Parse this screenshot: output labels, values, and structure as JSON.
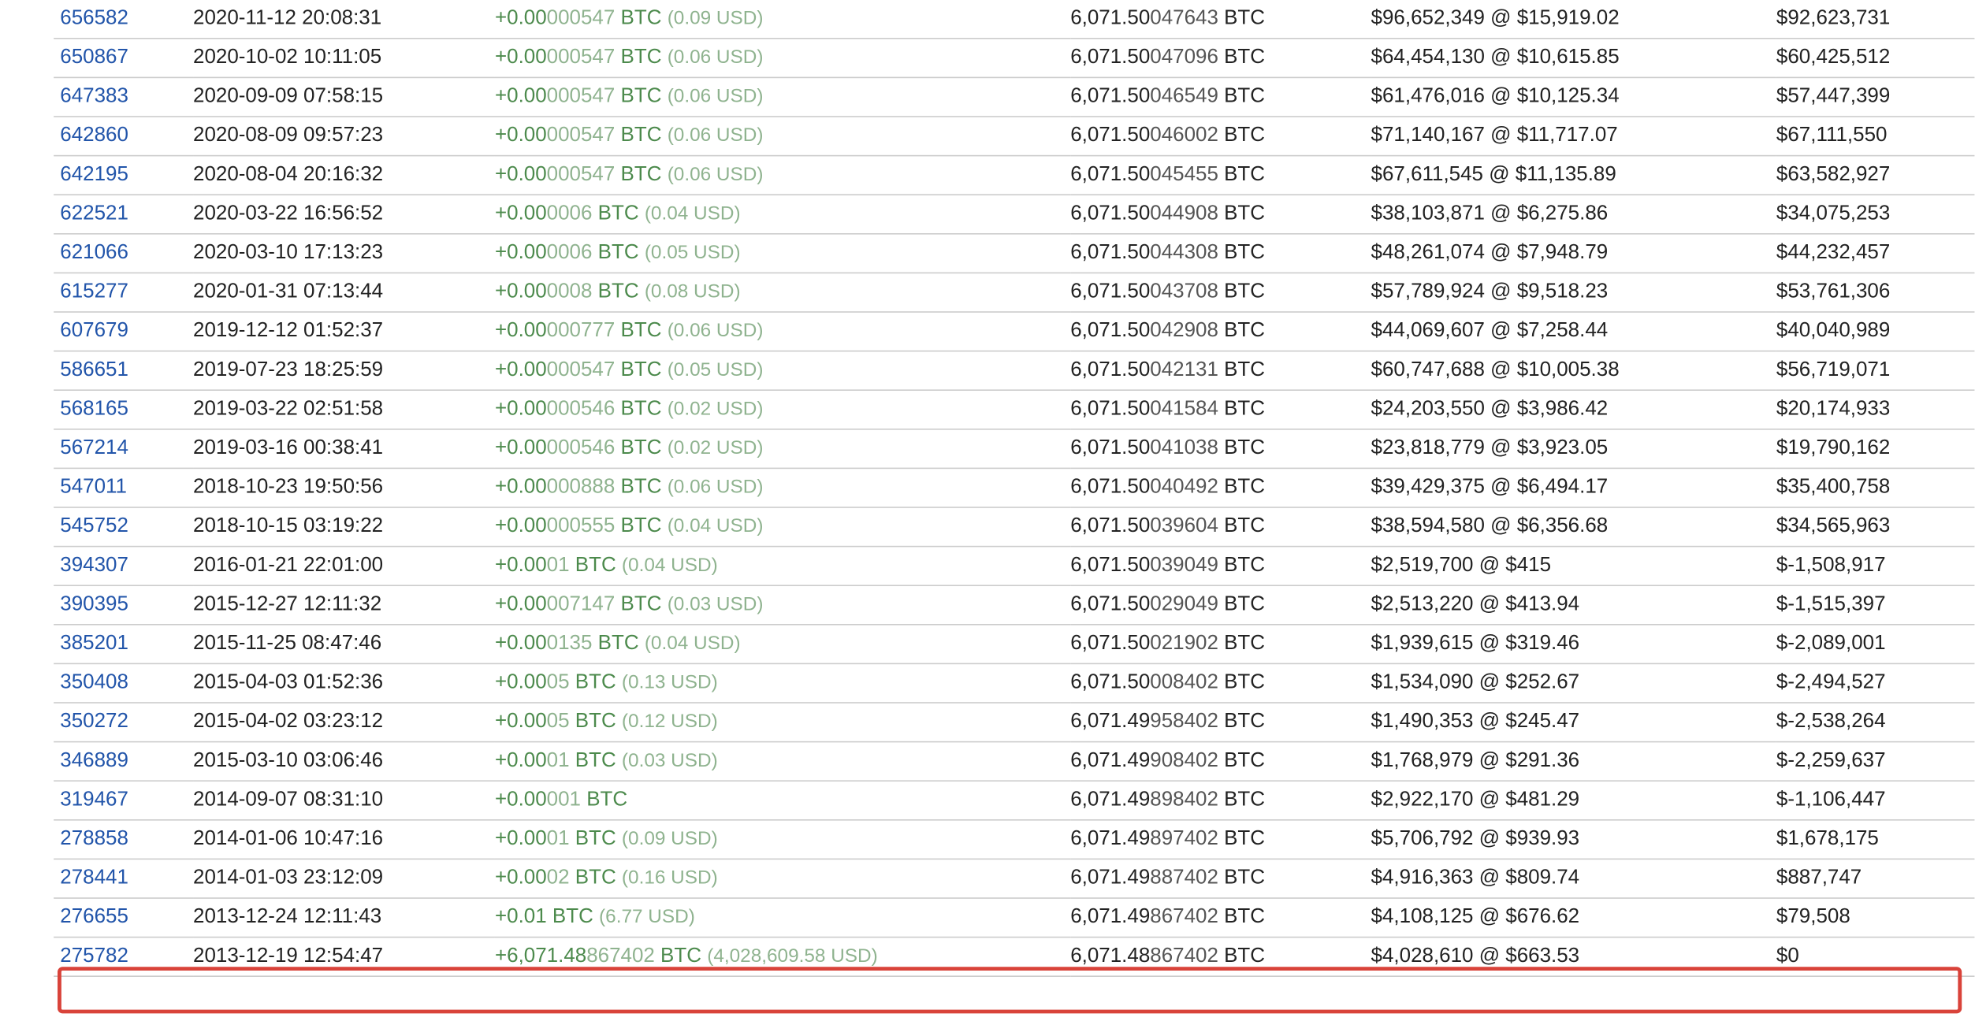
{
  "rows": [
    {
      "block": "656582",
      "time": "2020-11-12 20:08:31",
      "amt_main": "+0.00",
      "amt_dim": "000547",
      "amt_unit": " BTC",
      "amt_usd": "(0.09 USD)",
      "bal_main": "6,071.50",
      "bal_dim": "047643",
      "bal_unit": " BTC",
      "value": "$96,652,349 @ $15,919.02",
      "profit": "$92,623,731"
    },
    {
      "block": "650867",
      "time": "2020-10-02 10:11:05",
      "amt_main": "+0.00",
      "amt_dim": "000547",
      "amt_unit": " BTC",
      "amt_usd": "(0.06 USD)",
      "bal_main": "6,071.50",
      "bal_dim": "047096",
      "bal_unit": " BTC",
      "value": "$64,454,130 @ $10,615.85",
      "profit": "$60,425,512"
    },
    {
      "block": "647383",
      "time": "2020-09-09 07:58:15",
      "amt_main": "+0.00",
      "amt_dim": "000547",
      "amt_unit": " BTC",
      "amt_usd": "(0.06 USD)",
      "bal_main": "6,071.50",
      "bal_dim": "046549",
      "bal_unit": " BTC",
      "value": "$61,476,016 @ $10,125.34",
      "profit": "$57,447,399"
    },
    {
      "block": "642860",
      "time": "2020-08-09 09:57:23",
      "amt_main": "+0.00",
      "amt_dim": "000547",
      "amt_unit": " BTC",
      "amt_usd": "(0.06 USD)",
      "bal_main": "6,071.50",
      "bal_dim": "046002",
      "bal_unit": " BTC",
      "value": "$71,140,167 @ $11,717.07",
      "profit": "$67,111,550"
    },
    {
      "block": "642195",
      "time": "2020-08-04 20:16:32",
      "amt_main": "+0.00",
      "amt_dim": "000547",
      "amt_unit": " BTC",
      "amt_usd": "(0.06 USD)",
      "bal_main": "6,071.50",
      "bal_dim": "045455",
      "bal_unit": " BTC",
      "value": "$67,611,545 @ $11,135.89",
      "profit": "$63,582,927"
    },
    {
      "block": "622521",
      "time": "2020-03-22 16:56:52",
      "amt_main": "+0.00",
      "amt_dim": "0006",
      "amt_unit": " BTC",
      "amt_usd": "(0.04 USD)",
      "bal_main": "6,071.50",
      "bal_dim": "044908",
      "bal_unit": " BTC",
      "value": "$38,103,871 @ $6,275.86",
      "profit": "$34,075,253"
    },
    {
      "block": "621066",
      "time": "2020-03-10 17:13:23",
      "amt_main": "+0.00",
      "amt_dim": "0006",
      "amt_unit": " BTC",
      "amt_usd": "(0.05 USD)",
      "bal_main": "6,071.50",
      "bal_dim": "044308",
      "bal_unit": " BTC",
      "value": "$48,261,074 @ $7,948.79",
      "profit": "$44,232,457"
    },
    {
      "block": "615277",
      "time": "2020-01-31 07:13:44",
      "amt_main": "+0.00",
      "amt_dim": "0008",
      "amt_unit": " BTC",
      "amt_usd": "(0.08 USD)",
      "bal_main": "6,071.50",
      "bal_dim": "043708",
      "bal_unit": " BTC",
      "value": "$57,789,924 @ $9,518.23",
      "profit": "$53,761,306"
    },
    {
      "block": "607679",
      "time": "2019-12-12 01:52:37",
      "amt_main": "+0.00",
      "amt_dim": "000777",
      "amt_unit": " BTC",
      "amt_usd": "(0.06 USD)",
      "bal_main": "6,071.50",
      "bal_dim": "042908",
      "bal_unit": " BTC",
      "value": "$44,069,607 @ $7,258.44",
      "profit": "$40,040,989"
    },
    {
      "block": "586651",
      "time": "2019-07-23 18:25:59",
      "amt_main": "+0.00",
      "amt_dim": "000547",
      "amt_unit": " BTC",
      "amt_usd": "(0.05 USD)",
      "bal_main": "6,071.50",
      "bal_dim": "042131",
      "bal_unit": " BTC",
      "value": "$60,747,688 @ $10,005.38",
      "profit": "$56,719,071"
    },
    {
      "block": "568165",
      "time": "2019-03-22 02:51:58",
      "amt_main": "+0.00",
      "amt_dim": "000546",
      "amt_unit": " BTC",
      "amt_usd": "(0.02 USD)",
      "bal_main": "6,071.50",
      "bal_dim": "041584",
      "bal_unit": " BTC",
      "value": "$24,203,550 @ $3,986.42",
      "profit": "$20,174,933"
    },
    {
      "block": "567214",
      "time": "2019-03-16 00:38:41",
      "amt_main": "+0.00",
      "amt_dim": "000546",
      "amt_unit": " BTC",
      "amt_usd": "(0.02 USD)",
      "bal_main": "6,071.50",
      "bal_dim": "041038",
      "bal_unit": " BTC",
      "value": "$23,818,779 @ $3,923.05",
      "profit": "$19,790,162"
    },
    {
      "block": "547011",
      "time": "2018-10-23 19:50:56",
      "amt_main": "+0.00",
      "amt_dim": "000888",
      "amt_unit": " BTC",
      "amt_usd": "(0.06 USD)",
      "bal_main": "6,071.50",
      "bal_dim": "040492",
      "bal_unit": " BTC",
      "value": "$39,429,375 @ $6,494.17",
      "profit": "$35,400,758"
    },
    {
      "block": "545752",
      "time": "2018-10-15 03:19:22",
      "amt_main": "+0.00",
      "amt_dim": "000555",
      "amt_unit": " BTC",
      "amt_usd": "(0.04 USD)",
      "bal_main": "6,071.50",
      "bal_dim": "039604",
      "bal_unit": " BTC",
      "value": "$38,594,580 @ $6,356.68",
      "profit": "$34,565,963"
    },
    {
      "block": "394307",
      "time": "2016-01-21 22:01:00",
      "amt_main": "+0.00",
      "amt_dim": "01",
      "amt_unit": " BTC",
      "amt_usd": "(0.04 USD)",
      "bal_main": "6,071.50",
      "bal_dim": "039049",
      "bal_unit": " BTC",
      "value": "$2,519,700 @ $415",
      "profit": "$-1,508,917"
    },
    {
      "block": "390395",
      "time": "2015-12-27 12:11:32",
      "amt_main": "+0.00",
      "amt_dim": "007147",
      "amt_unit": " BTC",
      "amt_usd": "(0.03 USD)",
      "bal_main": "6,071.50",
      "bal_dim": "029049",
      "bal_unit": " BTC",
      "value": "$2,513,220 @ $413.94",
      "profit": "$-1,515,397"
    },
    {
      "block": "385201",
      "time": "2015-11-25 08:47:46",
      "amt_main": "+0.00",
      "amt_dim": "0135",
      "amt_unit": " BTC",
      "amt_usd": "(0.04 USD)",
      "bal_main": "6,071.50",
      "bal_dim": "021902",
      "bal_unit": " BTC",
      "value": "$1,939,615 @ $319.46",
      "profit": "$-2,089,001"
    },
    {
      "block": "350408",
      "time": "2015-04-03 01:52:36",
      "amt_main": "+0.00",
      "amt_dim": "05",
      "amt_unit": " BTC",
      "amt_usd": "(0.13 USD)",
      "bal_main": "6,071.50",
      "bal_dim": "008402",
      "bal_unit": " BTC",
      "value": "$1,534,090 @ $252.67",
      "profit": "$-2,494,527"
    },
    {
      "block": "350272",
      "time": "2015-04-02 03:23:12",
      "amt_main": "+0.00",
      "amt_dim": "05",
      "amt_unit": " BTC",
      "amt_usd": "(0.12 USD)",
      "bal_main": "6,071.49",
      "bal_dim": "958402",
      "bal_unit": " BTC",
      "value": "$1,490,353 @ $245.47",
      "profit": "$-2,538,264"
    },
    {
      "block": "346889",
      "time": "2015-03-10 03:06:46",
      "amt_main": "+0.00",
      "amt_dim": "01",
      "amt_unit": " BTC",
      "amt_usd": "(0.03 USD)",
      "bal_main": "6,071.49",
      "bal_dim": "908402",
      "bal_unit": " BTC",
      "value": "$1,768,979 @ $291.36",
      "profit": "$-2,259,637"
    },
    {
      "block": "319467",
      "time": "2014-09-07 08:31:10",
      "amt_main": "+0.00",
      "amt_dim": "001",
      "amt_unit": " BTC",
      "amt_usd": "",
      "bal_main": "6,071.49",
      "bal_dim": "898402",
      "bal_unit": " BTC",
      "value": "$2,922,170 @ $481.29",
      "profit": "$-1,106,447"
    },
    {
      "block": "278858",
      "time": "2014-01-06 10:47:16",
      "amt_main": "+0.00",
      "amt_dim": "01",
      "amt_unit": " BTC",
      "amt_usd": "(0.09 USD)",
      "bal_main": "6,071.49",
      "bal_dim": "897402",
      "bal_unit": " BTC",
      "value": "$5,706,792 @ $939.93",
      "profit": "$1,678,175"
    },
    {
      "block": "278441",
      "time": "2014-01-03 23:12:09",
      "amt_main": "+0.00",
      "amt_dim": "02",
      "amt_unit": " BTC",
      "amt_usd": "(0.16 USD)",
      "bal_main": "6,071.49",
      "bal_dim": "887402",
      "bal_unit": " BTC",
      "value": "$4,916,363 @ $809.74",
      "profit": "$887,747"
    },
    {
      "block": "276655",
      "time": "2013-12-24 12:11:43",
      "amt_main": "+0.01",
      "amt_dim": "",
      "amt_unit": " BTC",
      "amt_usd": "(6.77 USD)",
      "bal_main": "6,071.49",
      "bal_dim": "867402",
      "bal_unit": " BTC",
      "value": "$4,108,125 @ $676.62",
      "profit": "$79,508"
    },
    {
      "block": "275782",
      "time": "2013-12-19 12:54:47",
      "amt_main": "+6,071.48",
      "amt_dim": "867402",
      "amt_unit": " BTC",
      "amt_usd": "(4,028,609.58 USD)",
      "bal_main": "6,071.48",
      "bal_dim": "867402",
      "bal_unit": " BTC",
      "value": "$4,028,610 @ $663.53",
      "profit": "$0"
    }
  ],
  "colors": {
    "link": "#2255aa",
    "amount_green": "#4c8a4c",
    "amount_dim": "#8fb38f",
    "highlight_border": "#d9433a",
    "row_divider": "#cccccc"
  },
  "highlighted_block": "275782"
}
